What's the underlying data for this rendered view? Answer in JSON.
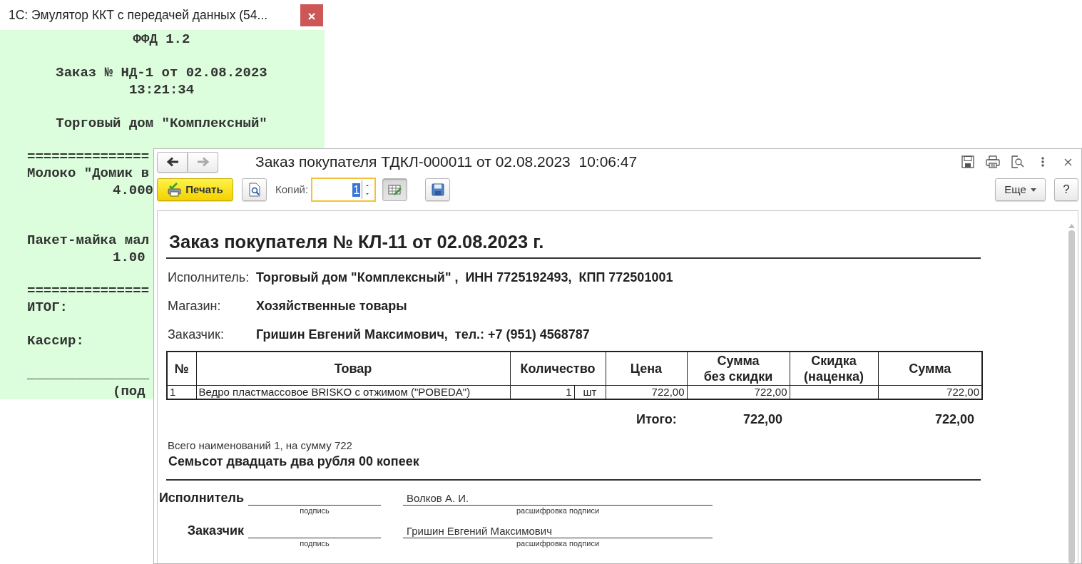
{
  "emulator_window": {
    "title": "1С: Эмулятор ККТ с передачей данных (54...",
    "receipt": [
      {
        "lines": [
          {
            "kind": "centered",
            "text": "ФФД 1.2"
          }
        ]
      },
      {
        "lines": [
          {
            "kind": "centered",
            "text": "Заказ № НД-1 от 02.08.2023"
          },
          {
            "kind": "centered",
            "text": "13:21:34"
          }
        ]
      },
      {
        "lines": [
          {
            "kind": "centered",
            "text": "Торговый дом \"Комплексный\""
          }
        ]
      },
      {
        "lines": [
          {
            "kind": "plain",
            "text": "==============="
          },
          {
            "kind": "plain",
            "text": "Молоко \"Домик в"
          },
          {
            "kind": "quantity",
            "text": "4.000"
          }
        ]
      },
      {
        "lines": [
          {
            "kind": "plain",
            "text": "Пакет-майка мал"
          },
          {
            "kind": "quantity",
            "text": "1.00"
          }
        ]
      },
      {
        "lines": [
          {
            "kind": "plain",
            "text": "==============="
          },
          {
            "kind": "plain",
            "text": "ИТОГ:"
          }
        ]
      },
      {
        "lines": [
          {
            "kind": "plain",
            "text": "Кассир:"
          }
        ]
      },
      {
        "lines": [
          {
            "kind": "plain",
            "text": "_______________"
          },
          {
            "kind": "quantity",
            "text": "(под"
          }
        ]
      }
    ]
  },
  "document_window": {
    "title": "Заказ покупателя ТДКЛ-000011 от 02.08.2023  10:06:47",
    "back_enabled": true,
    "forward_enabled": false,
    "toolbar": {
      "print_button": "Печать",
      "copies_label": "Копий:",
      "copies_value": "1",
      "copies_value_selected": true,
      "edit_mode_on": true,
      "more_button": "Еще",
      "help_button": "?"
    },
    "document": {
      "heading": "Заказ покупателя № КЛ-11 от 02.08.2023 г.",
      "info": [
        {
          "label": "Исполнитель:",
          "value": "Торговый дом \"Комплексный\" ,  ИНН 7725192493,  КПП 772501001"
        },
        {
          "label": "Магазин:",
          "value": "Хозяйственные товары"
        },
        {
          "label": "Заказчик:",
          "value": "Гришин Евгений Максимович,  тел.: +7 (951) 4568787"
        }
      ],
      "table": {
        "columns": [
          {
            "lines": [
              "№"
            ]
          },
          {
            "lines": [
              "Товар"
            ]
          },
          {
            "lines": [
              "Количество"
            ]
          },
          {
            "lines": [
              "Цена"
            ]
          },
          {
            "lines": [
              "Сумма",
              "без скидки"
            ]
          },
          {
            "lines": [
              "Скидка",
              "(наценка)"
            ]
          },
          {
            "lines": [
              "Сумма"
            ]
          }
        ],
        "rows": [
          {
            "number": "1",
            "product": "Ведро пластмассовое BRISKO с отжимом (\"POBEDA\")",
            "quantity": "1",
            "unit": "шт",
            "price": "722,00",
            "amount_before_discount": "722,00",
            "amount": "722,00"
          }
        ]
      },
      "totals": {
        "label": "Итого:",
        "amount_before_discount": "722,00",
        "amount": "722,00"
      },
      "summary": "Всего наименований 1, на сумму 722",
      "amount_in_words": "Семьсот двадцать два рубля 00 копеек",
      "signatures": [
        {
          "role": "Исполнитель",
          "name": "Волков А. И.",
          "signature_caption": "подпись",
          "name_caption": "расшифровка подписи"
        },
        {
          "role": "Заказчик",
          "name": "Гришин Евгений Максимович",
          "signature_caption": "подпись",
          "name_caption": "расшифровка подписи"
        }
      ]
    }
  }
}
